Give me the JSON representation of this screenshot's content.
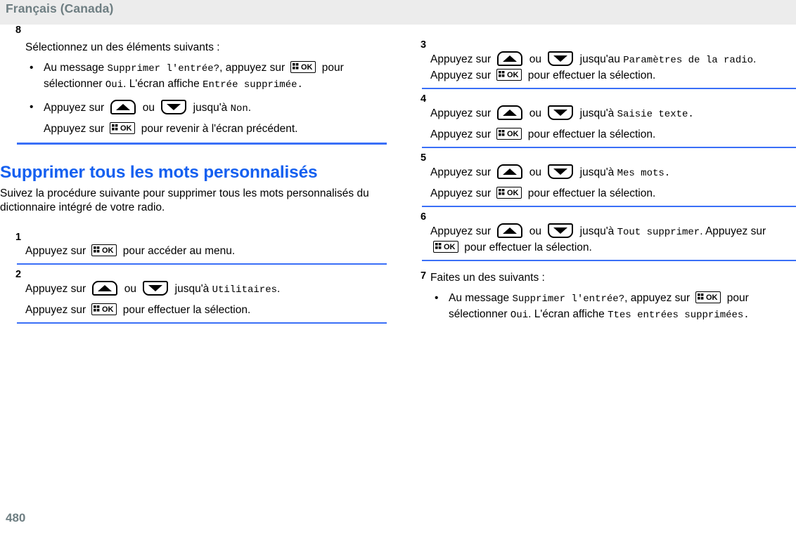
{
  "header": {
    "title": "Français (Canada)"
  },
  "footer": {
    "page_number": "480"
  },
  "colors": {
    "heading_blue": "#1560f0",
    "rule_blue": "#3a6ff7",
    "header_band": "#ececec",
    "header_text": "#6e7e82"
  },
  "icons": {
    "ok_key": "ok-button-icon",
    "up_key": "up-arrow-button-icon",
    "down_key": "down-arrow-button-icon",
    "ok_label": "OK"
  },
  "left_column": {
    "step8": {
      "number": "8",
      "intro": "Sélectionnez un des éléments suivants :",
      "bullets": [
        {
          "dot": "•",
          "seg1": "Au message ",
          "screen1": "Supprimer l'entrée?",
          "seg2": ", appuyez sur ",
          "seg3": " pour sélectionner ",
          "screen2": "Oui",
          "seg4": ". L'écran affiche ",
          "screen3": "Entrée supprimée."
        },
        {
          "dot": "•",
          "seg1": "Appuyez sur ",
          "seg2": " ou ",
          "seg3": " jusqu'à ",
          "screen1": "Non",
          "seg4": ".",
          "seg5": "Appuyez sur ",
          "seg6": " pour revenir à l'écran précédent."
        }
      ]
    },
    "section": {
      "heading": "Supprimer tous les mots personnalisés",
      "intro": "Suivez la procédure suivante pour supprimer tous les mots personnalisés du dictionnaire intégré de votre radio."
    },
    "step1": {
      "number": "1",
      "seg1": "Appuyez sur ",
      "seg2": " pour accéder au menu."
    },
    "step2": {
      "number": "2",
      "seg1": "Appuyez sur ",
      "seg2": " ou ",
      "seg3": " jusqu'à ",
      "screen1": "Utilitaires",
      "seg4": ".",
      "seg5": "Appuyez sur ",
      "seg6": " pour effectuer la sélection."
    }
  },
  "right_column": {
    "step3": {
      "number": "3",
      "seg1": "Appuyez sur ",
      "seg2": " ou ",
      "seg3": " jusqu'au ",
      "screen1": "Paramètres de la radio",
      "seg4": ". Appuyez sur ",
      "seg5": " pour effectuer la sélection."
    },
    "step4": {
      "number": "4",
      "seg1": "Appuyez sur ",
      "seg2": " ou ",
      "seg3": " jusqu'à ",
      "screen1": "Saisie texte.",
      "seg4": "Appuyez sur ",
      "seg5": " pour effectuer la sélection."
    },
    "step5": {
      "number": "5",
      "seg1": "Appuyez sur ",
      "seg2": " ou ",
      "seg3": " jusqu'à ",
      "screen1": "Mes mots.",
      "seg4": "Appuyez sur ",
      "seg5": " pour effectuer la sélection."
    },
    "step6": {
      "number": "6",
      "seg1": "Appuyez sur ",
      "seg2": " ou ",
      "seg3": " jusqu'à ",
      "screen1": "Tout supprimer",
      "seg4": ". Appuyez sur ",
      "seg5": " pour effectuer la sélection."
    },
    "step7": {
      "number": "7",
      "intro": "Faites un des suivants :",
      "bullets": [
        {
          "dot": "•",
          "seg1": "Au message ",
          "screen1": "Supprimer l'entrée?",
          "seg2": ", appuyez sur ",
          "seg3": " pour sélectionner ",
          "screen2": "Oui",
          "seg4": ". L'écran affiche ",
          "screen3": "Ttes entrées supprimées."
        }
      ]
    }
  }
}
